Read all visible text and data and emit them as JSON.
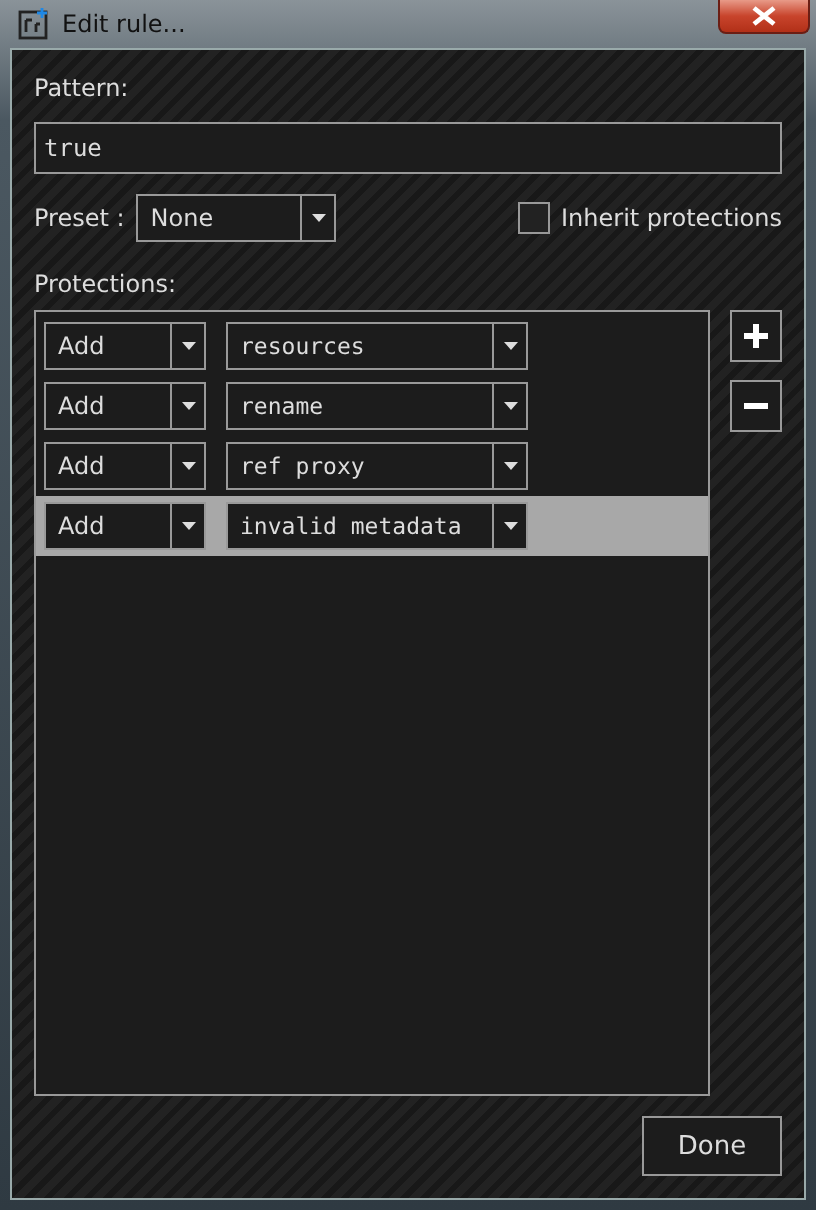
{
  "window": {
    "title": "Edit rule..."
  },
  "pattern": {
    "label": "Pattern:",
    "value": "true"
  },
  "preset": {
    "label": "Preset :",
    "value": "None"
  },
  "inherit": {
    "label": "Inherit protections",
    "checked": false
  },
  "protections": {
    "label": "Protections:",
    "rows": [
      {
        "action": "Add",
        "target": "resources",
        "selected": false
      },
      {
        "action": "Add",
        "target": "rename",
        "selected": false
      },
      {
        "action": "Add",
        "target": "ref proxy",
        "selected": false
      },
      {
        "action": "Add",
        "target": "invalid metadata",
        "selected": true
      }
    ]
  },
  "done": "Done"
}
